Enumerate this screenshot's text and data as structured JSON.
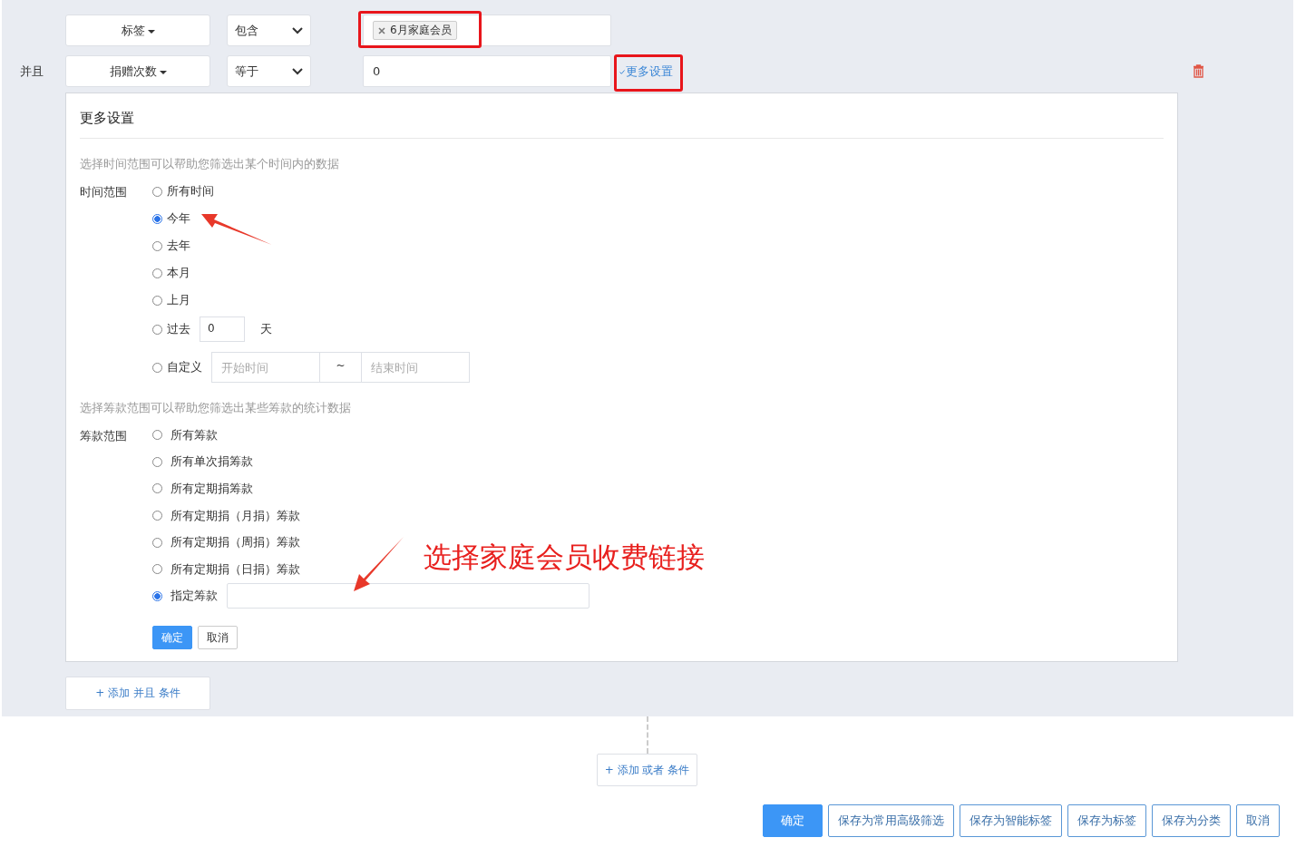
{
  "conditions": [
    {
      "kind": "tags",
      "field": "标签",
      "operator": "包含",
      "tags": [
        "6月家庭会员"
      ],
      "highlighted": true
    },
    {
      "kind": "value",
      "connector": "并且",
      "field": "捐赠次数",
      "operator": "等于",
      "value": "0",
      "more_link": "更多设置",
      "link_highlighted": true
    }
  ],
  "more_settings": {
    "title": "更多设置",
    "time_hint": "选择时间范围可以帮助您筛选出某个时间内的数据",
    "time_label": "时间范围",
    "time_options": [
      {
        "kind": "plain",
        "label": "所有时间",
        "selected": false
      },
      {
        "kind": "plain",
        "label": "今年",
        "selected": true
      },
      {
        "kind": "plain",
        "label": "去年",
        "selected": false
      },
      {
        "kind": "plain",
        "label": "本月",
        "selected": false
      },
      {
        "kind": "plain",
        "label": "上月",
        "selected": false
      },
      {
        "kind": "days",
        "label": "过去",
        "selected": false,
        "value": "0",
        "unit": "天"
      },
      {
        "kind": "custom",
        "label": "自定义",
        "selected": false,
        "start_placeholder": "开始时间",
        "separator": "~",
        "end_placeholder": "结束时间"
      }
    ],
    "fund_hint": "选择筹款范围可以帮助您筛选出某些筹款的统计数据",
    "fund_label": "筹款范围",
    "fund_options": [
      {
        "kind": "plain",
        "label": "所有筹款",
        "selected": false
      },
      {
        "kind": "plain",
        "label": "所有单次捐筹款",
        "selected": false
      },
      {
        "kind": "plain",
        "label": "所有定期捐筹款",
        "selected": false
      },
      {
        "kind": "plain",
        "label": "所有定期捐（月捐）筹款",
        "selected": false
      },
      {
        "kind": "plain",
        "label": "所有定期捐（周捐）筹款",
        "selected": false
      },
      {
        "kind": "plain",
        "label": "所有定期捐（日捐）筹款",
        "selected": false
      },
      {
        "kind": "field",
        "label": "指定筹款",
        "selected": true
      }
    ],
    "confirm": "确定",
    "cancel": "取消"
  },
  "add_and": "+ 添加 并且 条件",
  "add_or": "+ 添加 或者 条件",
  "footer_buttons": [
    {
      "kind": "primary",
      "label": "确定"
    },
    {
      "kind": "default",
      "label": "保存为常用高级筛选"
    },
    {
      "kind": "default",
      "label": "保存为智能标签"
    },
    {
      "kind": "default",
      "label": "保存为标签"
    },
    {
      "kind": "default",
      "label": "保存为分类"
    },
    {
      "kind": "default",
      "label": "取消"
    }
  ],
  "annotation": "选择家庭会员收费链接"
}
